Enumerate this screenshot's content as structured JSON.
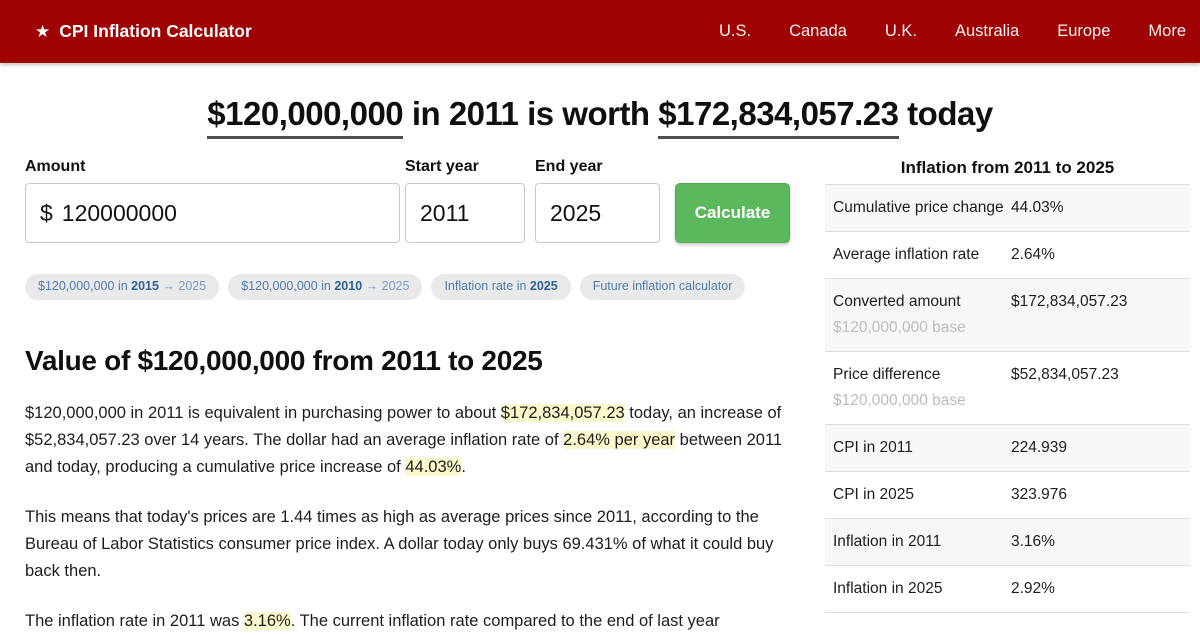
{
  "header": {
    "brand_icon": "★",
    "brand": "CPI Inflation Calculator",
    "nav": [
      "U.S.",
      "Canada",
      "U.K.",
      "Australia",
      "Europe",
      "More"
    ]
  },
  "title": {
    "amount_from": "$120,000,000",
    "middle": " in 2011 is worth ",
    "amount_to": "$172,834,057.23",
    "suffix": " today"
  },
  "calculator": {
    "amount_label": "Amount",
    "currency_prefix": "$",
    "amount_value": "120000000",
    "start_year_label": "Start year",
    "start_year_value": "2011",
    "end_year_label": "End year",
    "end_year_value": "2025",
    "calculate_label": "Calculate"
  },
  "related_links": [
    {
      "pre": "$120,000,000 in ",
      "bold": "2015",
      "post": " → 2025"
    },
    {
      "pre": "$120,000,000 in ",
      "bold": "2010",
      "post": " → 2025"
    },
    {
      "pre": "Inflation rate in ",
      "bold": "2025",
      "post": ""
    },
    {
      "pre": "Future inflation calculator",
      "bold": "",
      "post": ""
    }
  ],
  "article": {
    "heading": "Value of $120,000,000 from 2011 to 2025",
    "paragraphs": [
      [
        {
          "t": "$120,000,000 in 2011 is equivalent in purchasing power to about ",
          "h": false
        },
        {
          "t": "$172,834,057.23",
          "h": true
        },
        {
          "t": " today, an increase of $52,834,057.23 over 14 years. The dollar had an average inflation rate of ",
          "h": false
        },
        {
          "t": "2.64% per year",
          "h": true
        },
        {
          "t": " between 2011 and today, producing a cumulative price increase of ",
          "h": false
        },
        {
          "t": "44.03%",
          "h": true
        },
        {
          "t": ".",
          "h": false
        }
      ],
      [
        {
          "t": "This means that today's prices are 1.44 times as high as average prices since 2011, according to the Bureau of Labor Statistics consumer price index. A dollar today only buys 69.431% of what it could buy back then.",
          "h": false
        }
      ],
      [
        {
          "t": "The inflation rate in 2011 was ",
          "h": false
        },
        {
          "t": "3.16%",
          "h": true
        },
        {
          "t": ". The current inflation rate compared to the end of last year",
          "h": false
        }
      ]
    ]
  },
  "sidebar": {
    "title": "Inflation from 2011 to 2025",
    "rows": [
      {
        "label": "Cumulative price change",
        "sub": "",
        "value": "44.03%"
      },
      {
        "label": "Average inflation rate",
        "sub": "",
        "value": "2.64%"
      },
      {
        "label": "Converted amount",
        "sub": "$120,000,000 base",
        "value": "$172,834,057.23"
      },
      {
        "label": "Price difference",
        "sub": "$120,000,000 base",
        "value": "$52,834,057.23"
      },
      {
        "label": "CPI in 2011",
        "sub": "",
        "value": "224.939"
      },
      {
        "label": "CPI in 2025",
        "sub": "",
        "value": "323.976"
      },
      {
        "label": "Inflation in 2011",
        "sub": "",
        "value": "3.16%"
      },
      {
        "label": "Inflation in 2025",
        "sub": "",
        "value": "2.92%"
      }
    ]
  },
  "colors": {
    "header_red": "#9e0202",
    "accent_green": "#5cb85c",
    "chip_blue": "#4d7fae",
    "highlight_yellow": "#fcf8cc"
  }
}
